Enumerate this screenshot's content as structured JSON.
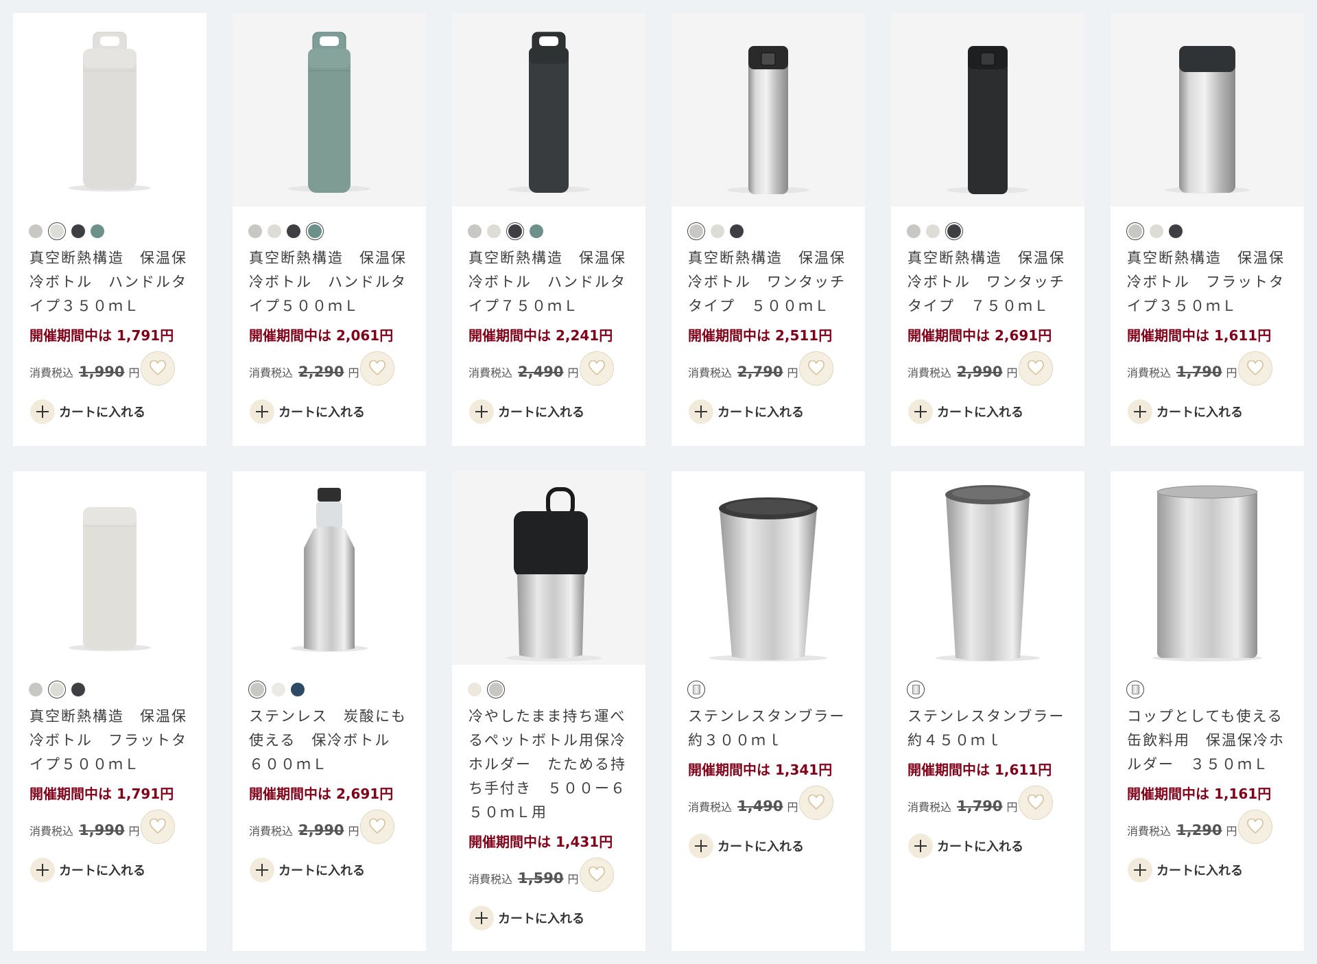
{
  "products": [
    {
      "name": "真空断熱構造　保温保冷ボトル　ハンドルタイプ３５０ｍＬ",
      "sale": "開催期間中は 1,791円",
      "tax_label": "消費税込",
      "orig_price": "1,990",
      "yen": "円",
      "cart_label": "カートに入れる",
      "image": "handle-bottle-light-gray",
      "swatches": [
        {
          "color": "#c9c7c3"
        },
        {
          "color": "#dedcd6",
          "selected": true
        },
        {
          "color": "#3d3f42"
        },
        {
          "color": "#6d908a"
        }
      ]
    },
    {
      "name": "真空断熱構造　保温保冷ボトル　ハンドルタイプ５００ｍＬ",
      "sale": "開催期間中は 2,061円",
      "tax_label": "消費税込",
      "orig_price": "2,290",
      "yen": "円",
      "cart_label": "カートに入れる",
      "image": "handle-bottle-sage-green",
      "swatches": [
        {
          "color": "#c9c7c3"
        },
        {
          "color": "#dedcd6"
        },
        {
          "color": "#3d3f42"
        },
        {
          "color": "#6d908a",
          "selected": true
        }
      ]
    },
    {
      "name": "真空断熱構造　保温保冷ボトル　ハンドルタイプ７５０ｍＬ",
      "sale": "開催期間中は 2,241円",
      "tax_label": "消費税込",
      "orig_price": "2,490",
      "yen": "円",
      "cart_label": "カートに入れる",
      "image": "handle-bottle-dark-gray",
      "swatches": [
        {
          "color": "#c9c7c3"
        },
        {
          "color": "#dedcd6"
        },
        {
          "color": "#3d3f42",
          "selected": true
        },
        {
          "color": "#6d908a"
        }
      ]
    },
    {
      "name": "真空断熱構造　保温保冷ボトル　ワンタッチタイプ　５００ｍＬ",
      "sale": "開催期間中は 2,511円",
      "tax_label": "消費税込",
      "orig_price": "2,790",
      "yen": "円",
      "cart_label": "カートに入れる",
      "image": "onetouch-bottle-silver",
      "swatches": [
        {
          "color": "#c9c7c3",
          "selected": true
        },
        {
          "color": "#dedcd6"
        },
        {
          "color": "#3d3f42"
        }
      ]
    },
    {
      "name": "真空断熱構造　保温保冷ボトル　ワンタッチタイプ　７５０ｍＬ",
      "sale": "開催期間中は 2,691円",
      "tax_label": "消費税込",
      "orig_price": "2,990",
      "yen": "円",
      "cart_label": "カートに入れる",
      "image": "onetouch-bottle-black",
      "swatches": [
        {
          "color": "#c9c7c3"
        },
        {
          "color": "#dedcd6"
        },
        {
          "color": "#3d3f42",
          "selected": true
        }
      ]
    },
    {
      "name": "真空断熱構造　保温保冷ボトル　フラットタイプ３５０ｍＬ",
      "sale": "開催期間中は 1,611円",
      "tax_label": "消費税込",
      "orig_price": "1,790",
      "yen": "円",
      "cart_label": "カートに入れる",
      "image": "flat-bottle-silver",
      "swatches": [
        {
          "color": "#c9c7c3",
          "selected": true
        },
        {
          "color": "#dedcd6"
        },
        {
          "color": "#3d3f42"
        }
      ]
    },
    {
      "name": "真空断熱構造　保温保冷ボトル　フラットタイプ５００ｍＬ",
      "sale": "開催期間中は 1,791円",
      "tax_label": "消費税込",
      "orig_price": "1,990",
      "yen": "円",
      "cart_label": "カートに入れる",
      "image": "flat-bottle-light-gray",
      "swatches": [
        {
          "color": "#c9c7c3"
        },
        {
          "color": "#dedcd6",
          "selected": true
        },
        {
          "color": "#3d3f42"
        }
      ]
    },
    {
      "name": "ステンレス　炭酸にも使える　保冷ボトル　６００ｍＬ",
      "sale": "開催期間中は 2,691円",
      "tax_label": "消費税込",
      "orig_price": "2,990",
      "yen": "円",
      "cart_label": "カートに入れる",
      "image": "carbonated-bottle-steel",
      "swatches": [
        {
          "color": "#c9c7c3",
          "selected": true
        },
        {
          "color": "#eceae6"
        },
        {
          "color": "#2c4a63"
        }
      ]
    },
    {
      "name": "冷やしたまま持ち運べるペットボトル用保冷ホルダー　たためる持ち手付き　５００ー６５０ｍＬ用",
      "sale": "開催期間中は 1,431円",
      "tax_label": "消費税込",
      "orig_price": "1,590",
      "yen": "円",
      "cart_label": "カートに入れる",
      "image": "pet-bottle-holder",
      "swatches": [
        {
          "color": "#ece8de"
        },
        {
          "color": "#c9c7c3",
          "selected": true
        }
      ]
    },
    {
      "name": "ステンレスタンブラー約３００ｍｌ",
      "sale": "開催期間中は 1,341円",
      "tax_label": "消費税込",
      "orig_price": "1,490",
      "yen": "円",
      "cart_label": "カートに入れる",
      "image": "tumbler-300",
      "swatches": [
        {
          "thumb": true
        }
      ]
    },
    {
      "name": "ステンレスタンブラー約４５０ｍｌ",
      "sale": "開催期間中は 1,611円",
      "tax_label": "消費税込",
      "orig_price": "1,790",
      "yen": "円",
      "cart_label": "カートに入れる",
      "image": "tumbler-450",
      "swatches": [
        {
          "thumb": true
        }
      ]
    },
    {
      "name": "コップとしても使える缶飲料用　保温保冷ホルダー　３５０ｍＬ",
      "sale": "開催期間中は 1,161円",
      "tax_label": "消費税込",
      "orig_price": "1,290",
      "yen": "円",
      "cart_label": "カートに入れる",
      "image": "can-holder-350",
      "swatches": [
        {
          "thumb": true
        }
      ]
    }
  ]
}
